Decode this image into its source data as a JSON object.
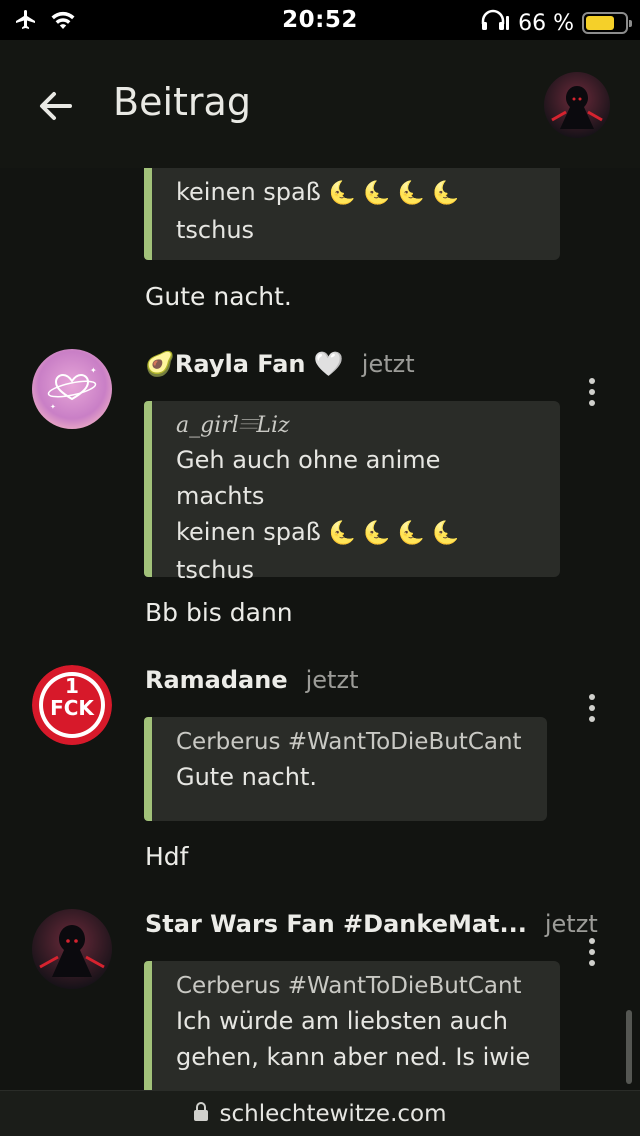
{
  "status_bar": {
    "time": "20:52",
    "battery_percent_label": "66 %",
    "battery_level": 0.66,
    "icons": [
      "airplane-icon",
      "wifi-icon",
      "headphones-icon",
      "battery-icon"
    ]
  },
  "header": {
    "title": "Beitrag",
    "back_icon": "arrow-left-icon"
  },
  "posts": [
    {
      "quote_text_lines": [
        "keinen spaß",
        "tschus"
      ],
      "moons": "🌜 🌜 🌜 🌜",
      "text": "Gute nacht."
    },
    {
      "author": "Rayla Fan",
      "author_emoji_prefix": "🥑",
      "author_emoji_suffix": "🤍",
      "time": "jetzt",
      "quote_author": "𝑎_𝑔𝑖𝑟𝑙𝄘𝐿𝑖𝑧",
      "quote_lines": [
        "Geh auch ohne anime machts",
        "keinen spaß",
        "tschus"
      ],
      "moons": "🌜 🌜 🌜 🌜",
      "text": "Bb bis dann"
    },
    {
      "author": "Ramadane",
      "time": "jetzt",
      "avatar_text": "1FCK",
      "quote_author": "Cerberus #WantToDieButCant",
      "quote_lines": [
        "Gute nacht."
      ],
      "text": "Hdf"
    },
    {
      "author": "Star Wars Fan #DankeMat...",
      "time": "jetzt",
      "quote_author": "Cerberus #WantToDieButCant",
      "quote_lines": [
        "Ich würde am liebsten auch",
        "gehen, kann aber ned. Is iwie"
      ]
    }
  ],
  "url_bar": {
    "url": "schlechtewitze.com",
    "lock_icon": "lock-icon"
  },
  "colors": {
    "background": "#121411",
    "quote_bg": "#2a2c28",
    "quote_accent": "#a2c27a",
    "battery": "#f5d029"
  }
}
